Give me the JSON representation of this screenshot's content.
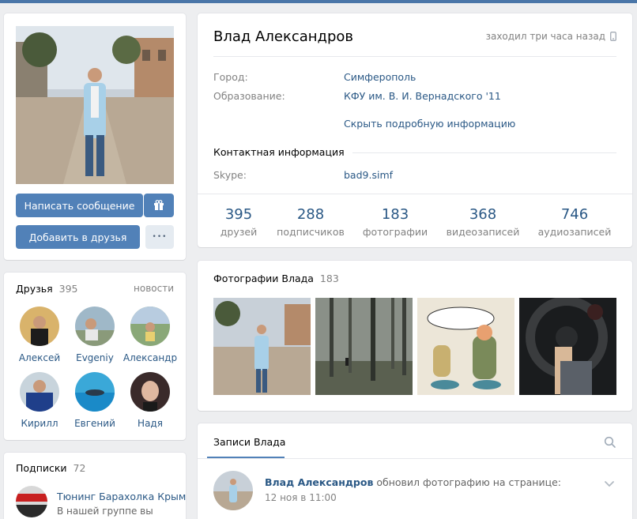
{
  "profile": {
    "name": "Влад Александров",
    "last_seen": "заходил три часа назад",
    "info_rows": [
      {
        "label": "Город:",
        "value": "Симферополь"
      },
      {
        "label": "Образование:",
        "value": "КФУ им. В. И. Вернадского '11"
      }
    ],
    "hide_details": "Скрыть подробную информацию",
    "contact_header": "Контактная информация",
    "skype_label": "Skype:",
    "skype_value": "bad9.simf",
    "counters": [
      {
        "num": "395",
        "label": "друзей"
      },
      {
        "num": "288",
        "label": "подписчиков"
      },
      {
        "num": "183",
        "label": "фотографии"
      },
      {
        "num": "368",
        "label": "видеозаписей"
      },
      {
        "num": "746",
        "label": "аудиозаписей"
      }
    ]
  },
  "actions": {
    "message": "Написать сообщение",
    "add_friend": "Добавить в друзья",
    "more": "•••"
  },
  "friends": {
    "title": "Друзья",
    "count": "395",
    "news_link": "новости",
    "items": [
      {
        "name": "Алексей"
      },
      {
        "name": "Evgeniy"
      },
      {
        "name": "Александр"
      },
      {
        "name": "Кирилл"
      },
      {
        "name": "Евгений"
      },
      {
        "name": "Надя"
      }
    ]
  },
  "subscriptions": {
    "title": "Подписки",
    "count": "72",
    "items": [
      {
        "name": "Тюнинг Барахолка Крым",
        "desc": "В нашей группе вы"
      }
    ]
  },
  "photos": {
    "title": "Фотографии Влада",
    "count": "183"
  },
  "wall": {
    "tab": "Записи Влада",
    "post": {
      "author": "Влад Александров",
      "action": "обновил фотографию на странице:",
      "time": "12 ноя в 11:00"
    }
  },
  "colors": {
    "accent": "#5181b8",
    "link": "#2a5885",
    "muted": "#828282",
    "background": "#edeef0"
  }
}
